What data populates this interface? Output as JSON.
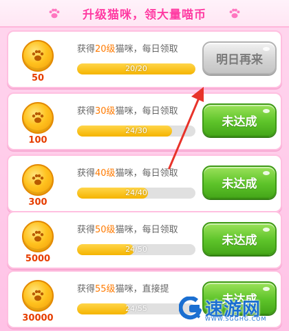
{
  "header": {
    "title": "升级猫咪，领大量喵币"
  },
  "tasks": [
    {
      "task_prefix": "获得",
      "level": "20级",
      "task_suffix": "猫咪，每日领取",
      "reward": "50",
      "progress_label": "20/20",
      "progress_value": 1.0,
      "button_label": "明日再来",
      "button_style": "gray"
    },
    {
      "task_prefix": "获得",
      "level": "30级",
      "task_suffix": "猫咪，每日领取",
      "reward": "100",
      "progress_label": "24/30",
      "progress_value": 0.8,
      "button_label": "未达成",
      "button_style": "green"
    },
    {
      "task_prefix": "获得",
      "level": "40级",
      "task_suffix": "猫咪，每日领取",
      "reward": "300",
      "progress_label": "24/40",
      "progress_value": 0.6,
      "button_label": "未达成",
      "button_style": "green"
    },
    {
      "task_prefix": "获得",
      "level": "50级",
      "task_suffix": "猫咪，每日领取",
      "reward": "5000",
      "progress_label": "24/50",
      "progress_value": 0.48,
      "button_label": "未达成",
      "button_style": "green"
    },
    {
      "task_prefix": "获得",
      "level": "55级",
      "task_suffix": "猫咪，直接提",
      "reward": "30000",
      "progress_label": "24/55",
      "progress_value": 0.436,
      "button_label": "未达成",
      "button_style": "green"
    }
  ],
  "watermark": {
    "text": "速游网",
    "url": "WWW.SGGHG.COM"
  },
  "colors": {
    "accent_pink": "#ff3aa2",
    "level_orange": "#ff7a00",
    "reward_red": "#e63d00",
    "button_green": "#5ec42a",
    "progress_yellow": "#f5b400",
    "arrow_red": "#e8332a",
    "watermark_blue": "#1b6fd1"
  },
  "icons": {
    "header_decor": "paw-icon",
    "coin": "paw-coin-icon",
    "watermark": "g-logo-icon"
  }
}
